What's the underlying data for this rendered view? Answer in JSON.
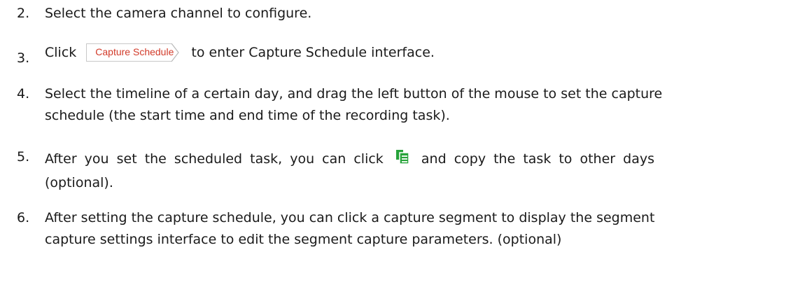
{
  "steps": [
    {
      "num": "2.",
      "text": "Select the camera channel to configure."
    },
    {
      "num": "3.",
      "before": "Click",
      "button_label": "Capture Schedule",
      "after": "to enter Capture Schedule interface."
    },
    {
      "num": "4.",
      "line1": "Select the timeline of a certain day, and drag the left button of the mouse to set the capture",
      "line2": "schedule (the start time and end time of the recording task)."
    },
    {
      "num": "5.",
      "before": "After you set the scheduled task, you can click",
      "icon": "copy-icon",
      "after": "and copy the task to other days",
      "line2": "(optional)."
    },
    {
      "num": "6.",
      "line1": "After setting the capture schedule, you can click a capture segment to display the segment",
      "line2": "capture settings interface to edit the segment capture parameters. (optional)"
    }
  ],
  "colors": {
    "button_text": "#d23b2a",
    "icon_green": "#27a33a"
  }
}
